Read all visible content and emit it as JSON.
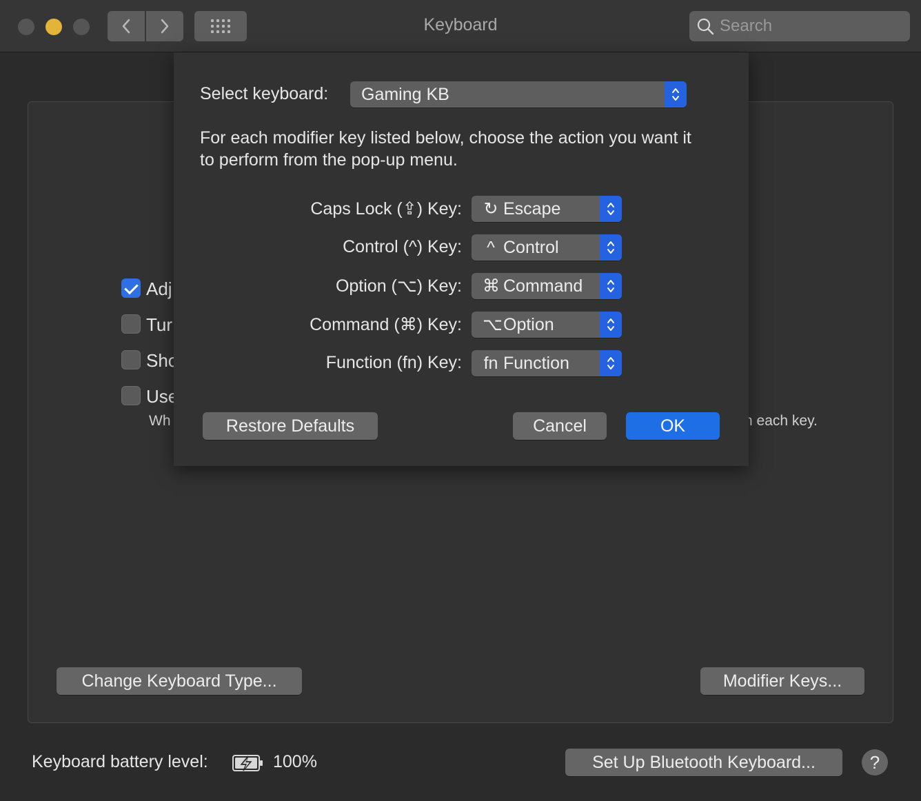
{
  "window": {
    "title": "Keyboard"
  },
  "search": {
    "placeholder": "Search"
  },
  "icons": {
    "back": "chevron-left-icon",
    "forward": "chevron-right-icon",
    "grid": "show-all-grid-icon",
    "search": "search-icon",
    "battery": "battery-charging-icon",
    "help": "help-icon",
    "stepper": "up-down-chevron-icon"
  },
  "colors": {
    "accent": "#1e6ee6",
    "minimize": "#e2b53a"
  },
  "panel": {
    "checkboxes": [
      {
        "label": "Adj",
        "checked": true
      },
      {
        "label": "Tur",
        "checked": false
      },
      {
        "label": "Sho",
        "checked": false
      },
      {
        "label": "Use",
        "checked": false
      }
    ],
    "subnote": "Wh",
    "right_note": "n each key.",
    "change_keyboard_type_label": "Change Keyboard Type...",
    "modifier_keys_label": "Modifier Keys..."
  },
  "footer": {
    "battery_label": "Keyboard battery level:",
    "battery_value": "100%",
    "bluetooth_button": "Set Up Bluetooth Keyboard...",
    "help_label": "?"
  },
  "sheet": {
    "select_keyboard_label": "Select keyboard:",
    "select_keyboard_value": "Gaming KB",
    "description": "For each modifier key listed below, choose the action you want it to perform from the pop-up menu.",
    "rows": [
      {
        "label": "Caps Lock (⇪) Key:",
        "icon": "↻",
        "value": "Escape"
      },
      {
        "label": "Control (^) Key:",
        "icon": "^",
        "value": "Control"
      },
      {
        "label": "Option (⌥) Key:",
        "icon": "⌘",
        "value": "Command"
      },
      {
        "label": "Command (⌘) Key:",
        "icon": "⌥",
        "value": "Option"
      },
      {
        "label": "Function (fn) Key:",
        "icon": "fn",
        "value": "Function"
      }
    ],
    "restore_defaults": "Restore Defaults",
    "cancel": "Cancel",
    "ok": "OK"
  }
}
